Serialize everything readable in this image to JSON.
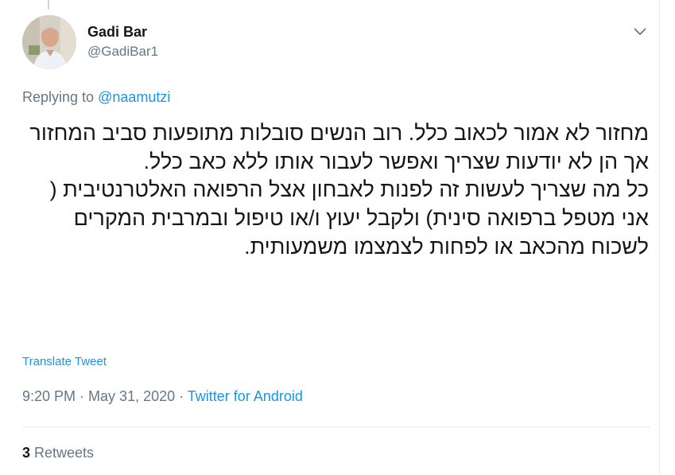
{
  "user": {
    "display_name": "Gadi Bar",
    "handle": "@GadiBar1"
  },
  "reply": {
    "prefix": "Replying to ",
    "to": "@naamutzi"
  },
  "tweet": {
    "text": "מחזור לא אמור לכאוב כלל. רוב הנשים סובלות מתופעות סביב המחזור אך הן לא יודעות שצריך ואפשר לעבור אותו ללא כאב כלל.\nכל מה שצריך לעשות זה לפנות לאבחון אצל הרפואה האלטרנטיבית ( אני מטפל ברפואה סינית) ולקבל יעוץ ו/או טיפול ובמרבית המקרים לשכוח מהכאב או לפחות לצמצמו משמעותית.",
    "translate_label": "Translate Tweet"
  },
  "meta": {
    "time": "9:20 PM",
    "separator": " · ",
    "date": "May 31, 2020",
    "source": "Twitter for Android"
  },
  "stats": {
    "retweets_count": "3",
    "retweets_label": " Retweets"
  },
  "icons": {
    "menu": "chevron-down-icon"
  },
  "colors": {
    "link": "#1b95e0",
    "secondary": "#657786",
    "text": "#14171a",
    "border": "#e6ecf0"
  }
}
